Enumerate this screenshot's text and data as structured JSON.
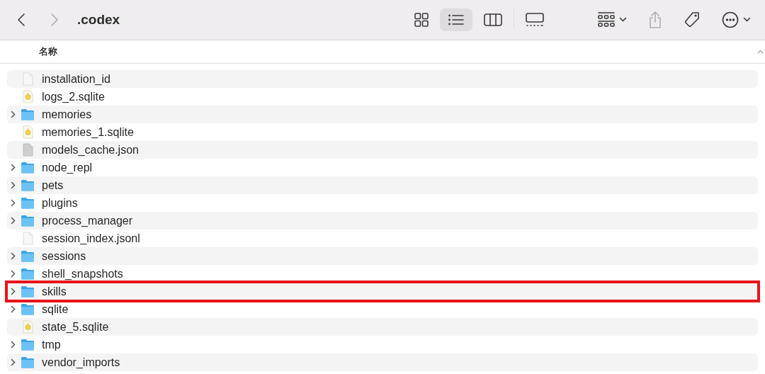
{
  "toolbar": {
    "nav": [
      {
        "kind": "back",
        "disabled": false
      },
      {
        "kind": "forward",
        "disabled": true
      }
    ],
    "title": ".codex",
    "views": [
      {
        "kind": "icons",
        "selected": false
      },
      {
        "kind": "list",
        "selected": true
      },
      {
        "kind": "columns",
        "selected": false
      },
      {
        "kind": "gallery",
        "selected": false
      }
    ],
    "actions": [
      {
        "kind": "group",
        "disabled": false
      },
      {
        "kind": "share",
        "disabled": true
      },
      {
        "kind": "tag",
        "disabled": false
      },
      {
        "kind": "more",
        "disabled": false
      }
    ]
  },
  "list": {
    "column": "名称",
    "rows": [
      {
        "name": "installation_id",
        "kind": "file",
        "highlighted": false
      },
      {
        "name": "logs_2.sqlite",
        "kind": "sqlite",
        "highlighted": false
      },
      {
        "name": "memories",
        "kind": "folder",
        "highlighted": false
      },
      {
        "name": "memories_1.sqlite",
        "kind": "sqlite",
        "highlighted": false
      },
      {
        "name": "models_cache.json",
        "kind": "json",
        "highlighted": false
      },
      {
        "name": "node_repl",
        "kind": "folder",
        "highlighted": false
      },
      {
        "name": "pets",
        "kind": "folder",
        "highlighted": false
      },
      {
        "name": "plugins",
        "kind": "folder",
        "highlighted": false
      },
      {
        "name": "process_manager",
        "kind": "folder",
        "highlighted": false
      },
      {
        "name": "session_index.jsonl",
        "kind": "file",
        "highlighted": false
      },
      {
        "name": "sessions",
        "kind": "folder",
        "highlighted": false
      },
      {
        "name": "shell_snapshots",
        "kind": "folder",
        "highlighted": false
      },
      {
        "name": "skills",
        "kind": "folder",
        "highlighted": true
      },
      {
        "name": "sqlite",
        "kind": "folder",
        "highlighted": false
      },
      {
        "name": "state_5.sqlite",
        "kind": "sqlite",
        "highlighted": false
      },
      {
        "name": "tmp",
        "kind": "folder",
        "highlighted": false
      },
      {
        "name": "vendor_imports",
        "kind": "folder",
        "highlighted": false
      }
    ]
  }
}
